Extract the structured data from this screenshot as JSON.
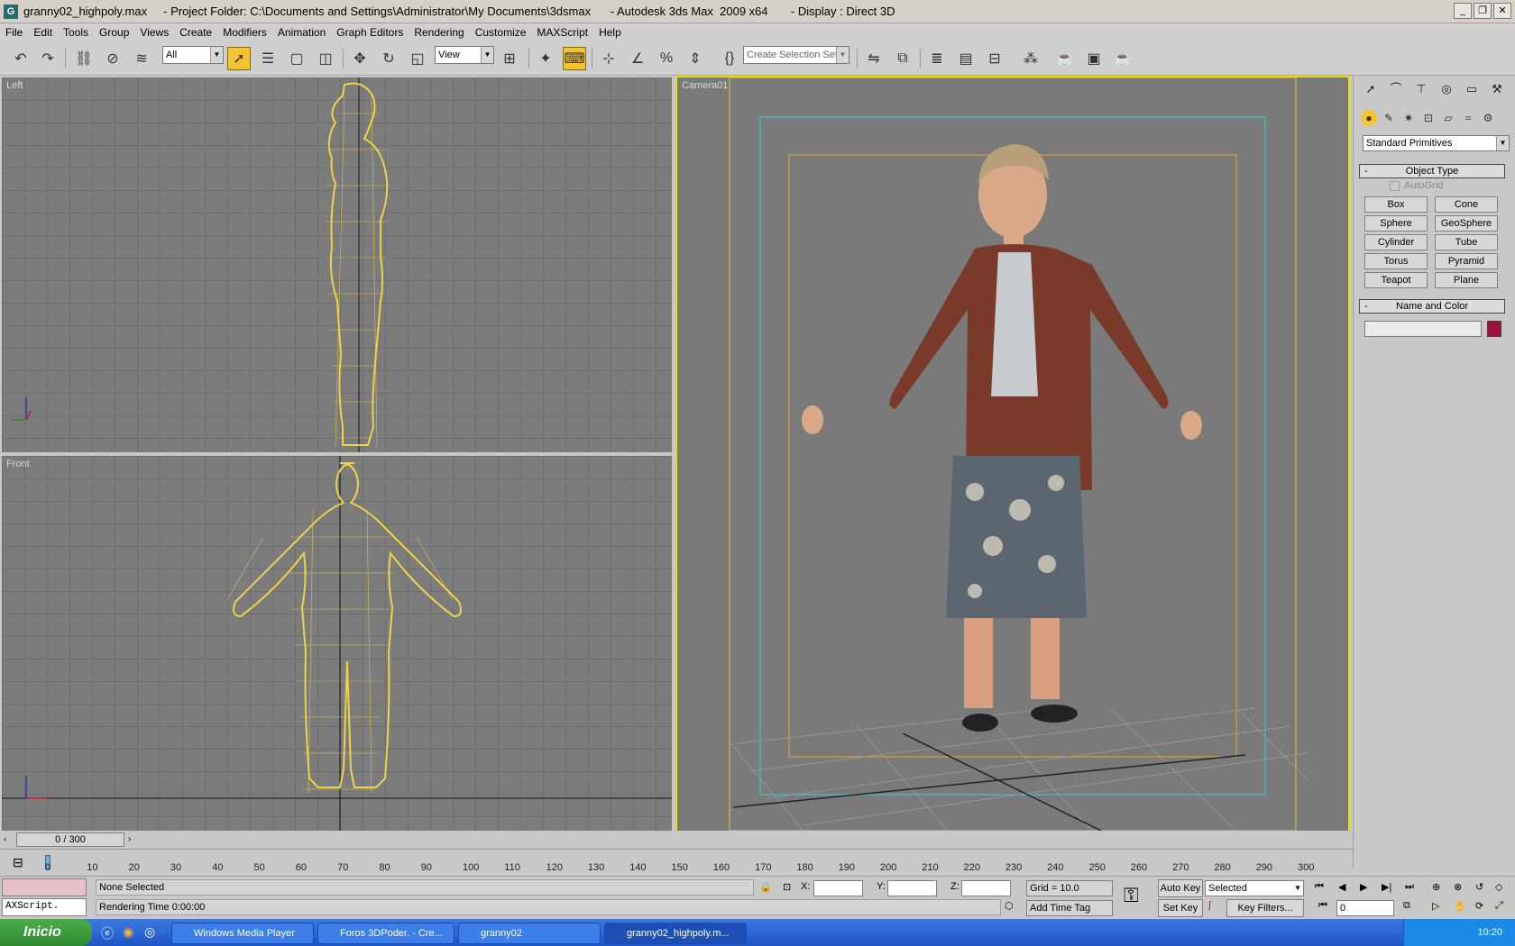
{
  "window": {
    "title": "granny02_highpoly.max     - Project Folder: C:\\Documents and Settings\\Administrator\\My Documents\\3dsmax      - Autodesk 3ds Max  2009 x64       - Display : Direct 3D"
  },
  "menu": [
    "File",
    "Edit",
    "Tools",
    "Group",
    "Views",
    "Create",
    "Modifiers",
    "Animation",
    "Graph Editors",
    "Rendering",
    "Customize",
    "MAXScript",
    "Help"
  ],
  "toolbar": {
    "filter": "All",
    "refcoord": "View",
    "selset": "Create Selection Set"
  },
  "viewports": {
    "left": "Left",
    "front": "Front",
    "camera": "Camera01"
  },
  "cmd": {
    "category": "Standard Primitives",
    "objtype": "Object Type",
    "autogrid": "AutoGrid",
    "buttons": [
      "Box",
      "Cone",
      "Sphere",
      "GeoSphere",
      "Cylinder",
      "Tube",
      "Torus",
      "Pyramid",
      "Teapot",
      "Plane"
    ],
    "namecolor": "Name and Color",
    "color": "#a0103a"
  },
  "time": {
    "slider": "0 / 300",
    "ticks": [
      "0",
      "10",
      "20",
      "30",
      "40",
      "50",
      "60",
      "70",
      "80",
      "90",
      "100",
      "110",
      "120",
      "130",
      "140",
      "150",
      "160",
      "170",
      "180",
      "190",
      "200",
      "210",
      "220",
      "230",
      "240",
      "250",
      "260",
      "270",
      "280",
      "290",
      "300"
    ]
  },
  "status": {
    "selected": "None Selected",
    "rendering": "Rendering Time  0:00:00",
    "script": "AXScript.",
    "x": "X:",
    "y": "Y:",
    "z": "Z:",
    "grid": "Grid = 10.0",
    "addtag": "Add Time Tag",
    "autokey": "Auto Key",
    "setkey": "Set Key",
    "selmode": "Selected",
    "keyfilters": "Key Filters...",
    "frame": "0"
  },
  "taskbar": {
    "start": "Inicio",
    "tasks": [
      "Windows Media Player",
      "Foros 3DPoder. - Cre...",
      "granny02",
      "granny02_highpoly.m..."
    ],
    "clock": "10:20"
  }
}
